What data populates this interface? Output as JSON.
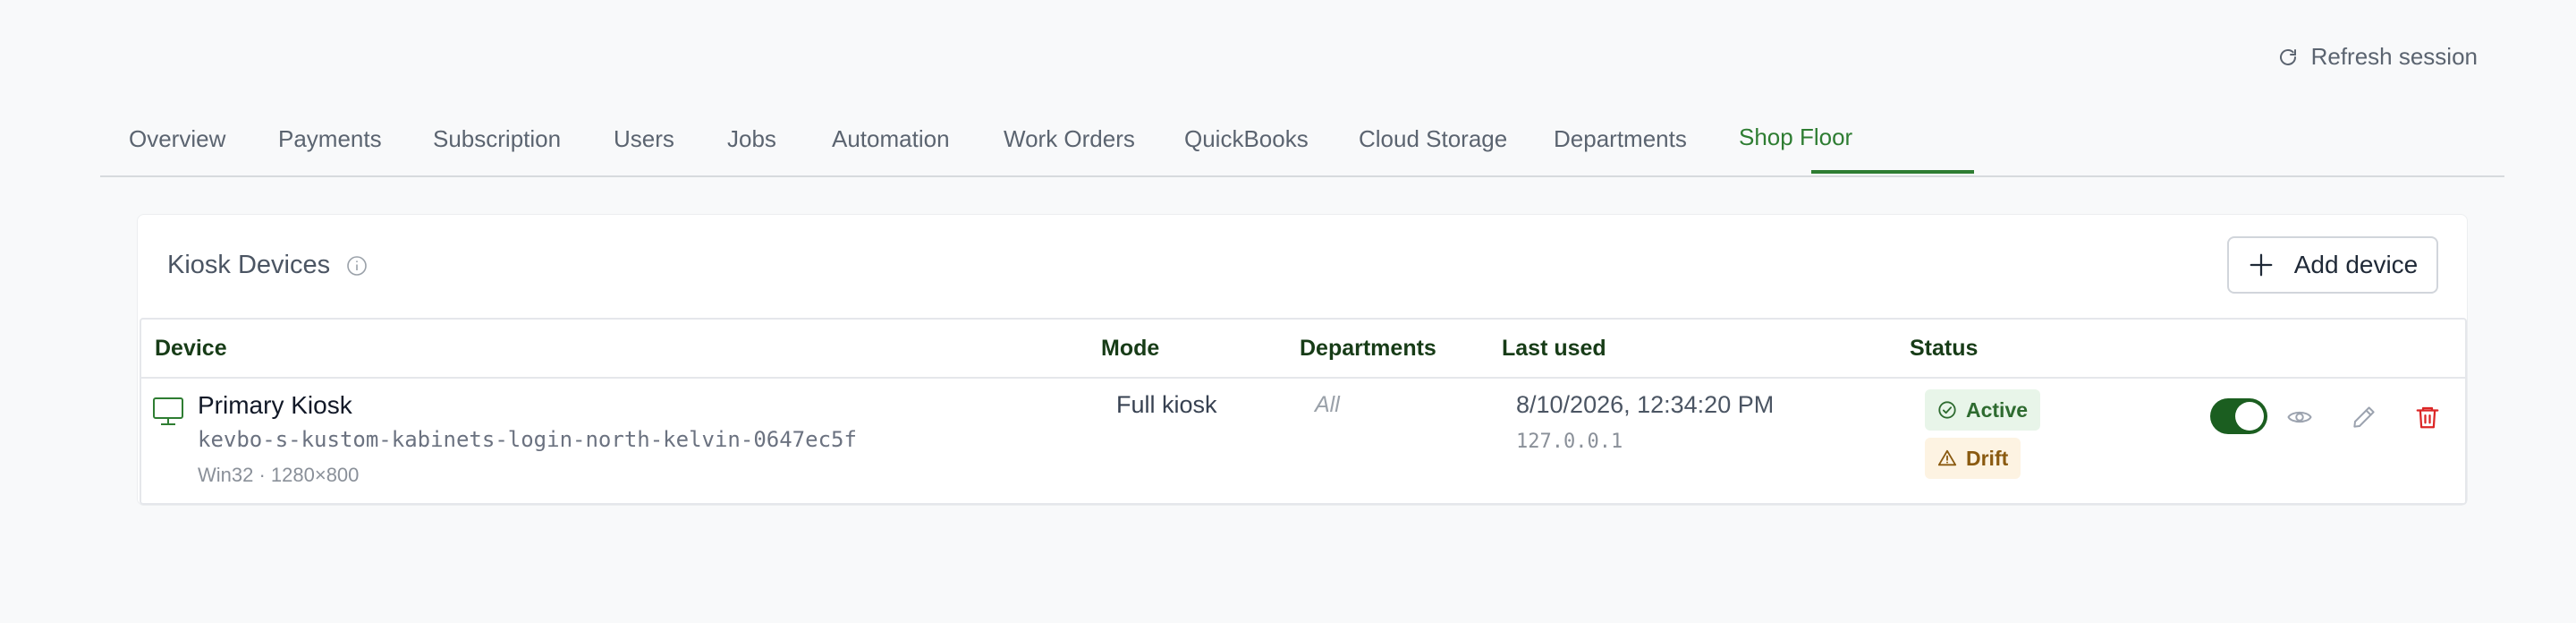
{
  "header": {
    "refresh_label": "Refresh session"
  },
  "tabs": [
    {
      "label": "Overview"
    },
    {
      "label": "Payments"
    },
    {
      "label": "Subscription"
    },
    {
      "label": "Users"
    },
    {
      "label": "Jobs"
    },
    {
      "label": "Automation"
    },
    {
      "label": "Work Orders"
    },
    {
      "label": "QuickBooks"
    },
    {
      "label": "Cloud Storage"
    },
    {
      "label": "Departments"
    },
    {
      "label": "Shop Floor",
      "active": true
    }
  ],
  "card": {
    "title": "Kiosk Devices",
    "add_button_label": "Add device"
  },
  "table": {
    "columns": [
      "Device",
      "Mode",
      "Departments",
      "Last used",
      "Status"
    ],
    "rows": [
      {
        "name": "Primary Kiosk",
        "device_id": "kevbo-s-kustom-kabinets-login-north-kelvin-0647ec5f",
        "meta": "Win32 · 1280×800",
        "mode": "Full kiosk",
        "departments": "All",
        "last_used": "8/10/2026, 12:34:20 PM",
        "ip": "127.0.0.1",
        "status_active": "Active",
        "status_drift": "Drift",
        "enabled": true
      }
    ]
  },
  "colors": {
    "accent": "#2e7d32",
    "toggle_on": "#1b5e20",
    "delete": "#dc2626",
    "active_badge_bg": "#e8f5e9",
    "drift_badge_bg": "#fdf3e2"
  },
  "icons": {
    "refresh": "refresh-icon",
    "info": "info-icon",
    "add": "plus-icon",
    "device": "monitor-icon",
    "active": "check-circle-icon",
    "drift": "warning-icon",
    "view": "eye-icon",
    "edit": "pencil-icon",
    "delete": "trash-icon"
  }
}
